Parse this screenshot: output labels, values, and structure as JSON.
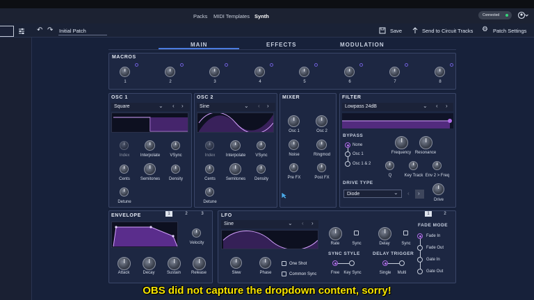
{
  "header": {
    "tabs": [
      "Packs",
      "MIDI Templates",
      "Synth"
    ],
    "connected": "Connected"
  },
  "toolbar": {
    "patch_name": "Initial Patch",
    "save": "Save",
    "send": "Send to Circuit Tracks",
    "settings": "Patch Settings"
  },
  "section_tabs": [
    "MAIN",
    "EFFECTS",
    "MODULATION"
  ],
  "macros": {
    "title": "MACROS",
    "labels": [
      "1",
      "2",
      "3",
      "4",
      "5",
      "6",
      "7",
      "8"
    ]
  },
  "osc1": {
    "title": "OSC 1",
    "waveform": "Square",
    "knobs_row1": [
      "Index",
      "Interpolate",
      "VSync"
    ],
    "knobs_row2": [
      "Cents",
      "Semitones",
      "Density"
    ],
    "knob_row3": "Detune"
  },
  "osc2": {
    "title": "OSC 2",
    "waveform": "Sine",
    "knobs_row1": [
      "Index",
      "Interpolate",
      "VSync"
    ],
    "knobs_row2": [
      "Cents",
      "Semitones",
      "Density"
    ],
    "knob_row3": "Detune"
  },
  "mixer": {
    "title": "MIXER",
    "knobs": [
      "Osc 1",
      "Osc 2",
      "Noise",
      "Ringmod",
      "Pre FX",
      "Post FX"
    ]
  },
  "filter": {
    "title": "FILTER",
    "type": "Lowpass 24dB",
    "bypass_title": "BYPASS",
    "bypass_options": [
      "None",
      "Osc 1",
      "Osc 1 & 2"
    ],
    "bypass_selected": "None",
    "knobs": [
      "Frequency",
      "Resonance",
      "Q",
      "Key Track",
      "Env 2 > Freq",
      "Drive"
    ],
    "drive_type_title": "DRIVE TYPE",
    "drive_type": "Diode"
  },
  "envelope": {
    "title": "ENVELOPE",
    "tabs": [
      "1",
      "2",
      "3"
    ],
    "selected_tab": "1",
    "velocity": "Velocity",
    "knobs": [
      "Attack",
      "Decay",
      "Sustain",
      "Release"
    ]
  },
  "lfo": {
    "title": "LFO",
    "tabs": [
      "1",
      "2"
    ],
    "selected_tab": "1",
    "waveform": "Sine",
    "rate": "Rate",
    "sync": "Sync",
    "delay": "Delay",
    "delay_sync": "Sync",
    "slew": "Slew",
    "phase": "Phase",
    "one_shot": "One Shot",
    "common_sync": "Common Sync",
    "sync_style_title": "SYNC STYLE",
    "sync_style_options": [
      "Free",
      "Key Sync"
    ],
    "delay_trigger_title": "DELAY TRIGGER",
    "delay_trigger_options": [
      "Single",
      "Multi"
    ],
    "fade_mode_title": "FADE MODE",
    "fade_mode_options": [
      "Fade In",
      "Fade Out",
      "Gate In",
      "Gate Out"
    ],
    "fade_mode_selected": "Fade In"
  },
  "caption": "OBS did not capture the dropdown content, sorry!",
  "colors": {
    "accent": "#4c7ce0",
    "purple": "#a95fe0",
    "caption": "#f6e400",
    "connected_dot": "#35d67a"
  }
}
